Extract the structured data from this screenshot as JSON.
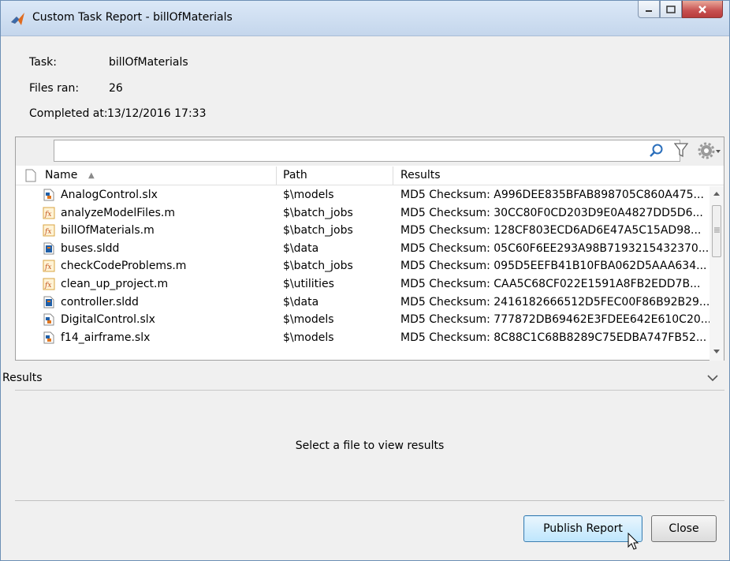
{
  "window": {
    "title": "Custom Task Report - billOfMaterials",
    "app_icon": "matlab-icon"
  },
  "info": {
    "task_label": "Task:",
    "task_value": "billOfMaterials",
    "files_label": "Files ran:",
    "files_value": "26",
    "completed_label": "Completed at:",
    "completed_value": "13/12/2016 17:33"
  },
  "search": {
    "value": "",
    "placeholder": ""
  },
  "table": {
    "columns": [
      "Name",
      "Path",
      "Results"
    ],
    "sort_indicator": "▲",
    "rows": [
      {
        "name": "AnalogControl.slx",
        "path": "$\\models",
        "result": "MD5 Checksum: A996DEE835BFAB898705C860A475...",
        "icon": "slx"
      },
      {
        "name": "analyzeModelFiles.m",
        "path": "$\\batch_jobs",
        "result": "MD5 Checksum: 30CC80F0CD203D9E0A4827DD5D6...",
        "icon": "fx"
      },
      {
        "name": "billOfMaterials.m",
        "path": "$\\batch_jobs",
        "result": "MD5 Checksum: 128CF803ECD6AD6E47A5C15AD98...",
        "icon": "fx"
      },
      {
        "name": "buses.sldd",
        "path": "$\\data",
        "result": "MD5 Checksum: 05C60F6EE293A98B7193215432370...",
        "icon": "sldd"
      },
      {
        "name": "checkCodeProblems.m",
        "path": "$\\batch_jobs",
        "result": "MD5 Checksum: 095D5EEFB41B10FBA062D5AAA634...",
        "icon": "fx"
      },
      {
        "name": "clean_up_project.m",
        "path": "$\\utilities",
        "result": "MD5 Checksum: CAA5C68CF022E1591A8FB2EDD7B...",
        "icon": "fx"
      },
      {
        "name": "controller.sldd",
        "path": "$\\data",
        "result": "MD5 Checksum: 2416182666512D5FEC00F86B92B29...",
        "icon": "sldd"
      },
      {
        "name": "DigitalControl.slx",
        "path": "$\\models",
        "result": "MD5 Checksum: 777872DB69462E3FDEE642E610C20...",
        "icon": "slx"
      },
      {
        "name": "f14_airframe.slx",
        "path": "$\\models",
        "result": "MD5 Checksum: 8C88C1C68B8289C75EDBA747FB52...",
        "icon": "slx"
      }
    ]
  },
  "results": {
    "header": "Results",
    "message": "Select a file to view results"
  },
  "buttons": {
    "publish": "Publish Report",
    "close": "Close"
  },
  "colors": {
    "titlebar": "#c4d6ec",
    "close_button": "#c75050",
    "primary_button": "#bee6fd"
  }
}
